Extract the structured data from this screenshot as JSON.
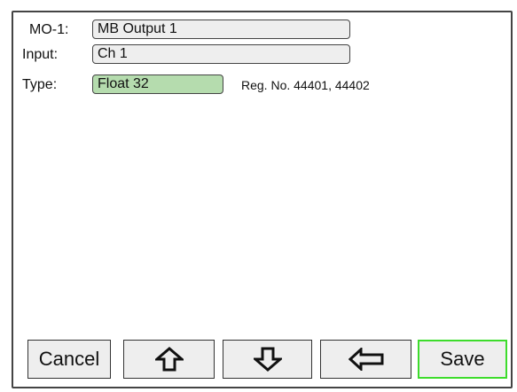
{
  "fields": {
    "mo": {
      "label": "MO-1:",
      "value": "MB Output 1"
    },
    "input": {
      "label": "Input:",
      "value": "Ch 1"
    },
    "type": {
      "label": "Type:",
      "value": "Float 32",
      "reg": "Reg. No. 44401, 44402"
    }
  },
  "buttons": {
    "cancel": "Cancel",
    "up": "up-arrow-icon",
    "down": "down-arrow-icon",
    "left": "left-arrow-icon",
    "save": "Save"
  },
  "colors": {
    "type_field_bg": "#b5dcae",
    "save_border": "#3ddc2c",
    "field_bg": "#eeeeee"
  }
}
